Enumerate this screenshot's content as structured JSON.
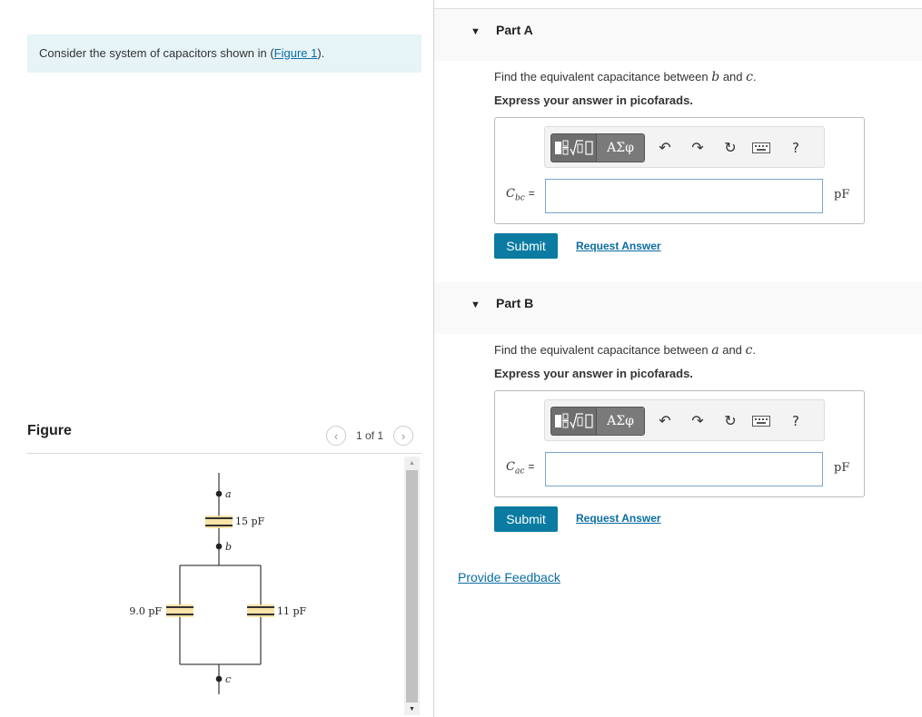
{
  "intro": {
    "text_before": "Consider the system of capacitors shown in (",
    "link": "Figure 1",
    "text_after": ")."
  },
  "figure": {
    "label": "Figure",
    "pager": "1 of 1",
    "circuit": {
      "node_a": "a",
      "node_b": "b",
      "node_c": "c",
      "cap_top": "15 pF",
      "cap_left": "9.0 pF",
      "cap_right": "11 pF"
    }
  },
  "parts": [
    {
      "title": "Part A",
      "question_pre": "Find the equivalent capacitance between",
      "var1": "b",
      "conj": "and",
      "var2": "c",
      "question_post": ".",
      "instruction": "Express your answer in picofarads.",
      "var_main": "C",
      "var_sub": "bc",
      "equals": "=",
      "input_value": "",
      "unit": "pF",
      "greek": "ΑΣφ",
      "help": "?",
      "submit": "Submit",
      "request": "Request Answer"
    },
    {
      "title": "Part B",
      "question_pre": "Find the equivalent capacitance between",
      "var1": "a",
      "conj": "and",
      "var2": "c",
      "question_post": ".",
      "instruction": "Express your answer in picofarads.",
      "var_main": "C",
      "var_sub": "ac",
      "equals": "=",
      "input_value": "",
      "unit": "pF",
      "greek": "ΑΣφ",
      "help": "?",
      "submit": "Submit",
      "request": "Request Answer"
    }
  ],
  "feedback": "Provide Feedback",
  "icons": {
    "undo": "undo-icon",
    "redo": "redo-icon",
    "reset": "reset-icon",
    "keyboard": "keyboard-icon",
    "help": "help-icon"
  },
  "colors": {
    "accent": "#0b7ba1",
    "link": "#0b6da1",
    "intro_bg": "#e6f4f8",
    "capacitor_highlight": "#f5d98b"
  }
}
